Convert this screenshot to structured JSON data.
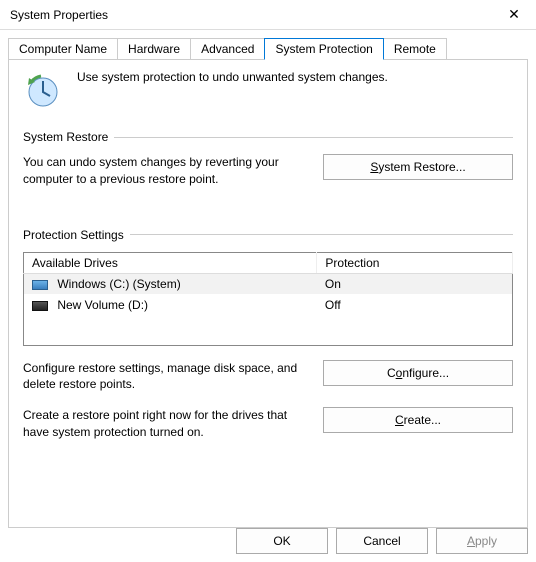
{
  "window": {
    "title": "System Properties"
  },
  "tabs": {
    "items": [
      "Computer Name",
      "Hardware",
      "Advanced",
      "System Protection",
      "Remote"
    ],
    "active_index": 3
  },
  "intro": {
    "text": "Use system protection to undo unwanted system changes."
  },
  "system_restore": {
    "title": "System Restore",
    "desc": "You can undo system changes by reverting your computer to a previous restore point.",
    "button": "System Restore..."
  },
  "protection_settings": {
    "title": "Protection Settings",
    "columns": [
      "Available Drives",
      "Protection"
    ],
    "rows": [
      {
        "icon": "win",
        "name": "Windows (C:) (System)",
        "protection": "On",
        "selected": true
      },
      {
        "icon": "vol",
        "name": "New Volume (D:)",
        "protection": "Off",
        "selected": false
      }
    ],
    "configure_desc": "Configure restore settings, manage disk space, and delete restore points.",
    "configure_button": "Configure...",
    "create_desc": "Create a restore point right now for the drives that have system protection turned on.",
    "create_button": "Create..."
  },
  "footer": {
    "ok": "OK",
    "cancel": "Cancel",
    "apply": "Apply"
  }
}
